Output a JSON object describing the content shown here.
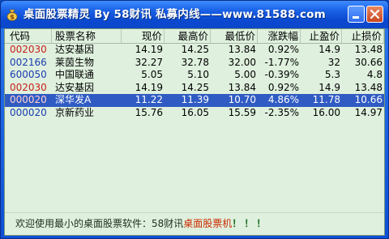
{
  "window": {
    "title": "桌面股票精灵 By 58财讯 私募内线——www.81588.com"
  },
  "table": {
    "columns": [
      "代码",
      "股票名称",
      "现价",
      "最高价",
      "最低价",
      "涨跌幅",
      "止盈价",
      "止损价"
    ],
    "rows": [
      {
        "code": "002030",
        "name": "达安基因",
        "price": "14.19",
        "high": "14.25",
        "low": "13.84",
        "change": "0.92%",
        "take_profit": "14.9",
        "stop_loss": "13.48",
        "code_color": "#c8201a"
      },
      {
        "code": "002166",
        "name": "莱茵生物",
        "price": "32.27",
        "high": "32.78",
        "low": "32.00",
        "change": "-1.77%",
        "take_profit": "32",
        "stop_loss": "30.66",
        "code_color": "#1a3bb0"
      },
      {
        "code": "600050",
        "name": "中国联通",
        "price": "5.05",
        "high": "5.10",
        "low": "5.00",
        "change": "-0.39%",
        "take_profit": "5.3",
        "stop_loss": "4.8",
        "code_color": "#1a3bb0"
      },
      {
        "code": "002030",
        "name": "达安基因",
        "price": "14.19",
        "high": "14.25",
        "low": "13.84",
        "change": "0.92%",
        "take_profit": "14.9",
        "stop_loss": "13.48",
        "code_color": "#c8201a"
      },
      {
        "code": "000020",
        "name": "深华发A",
        "price": "11.22",
        "high": "11.39",
        "low": "10.70",
        "change": "4.86%",
        "take_profit": "11.78",
        "stop_loss": "10.66",
        "code_color": "#ffd0d0",
        "selected": true
      },
      {
        "code": "000020",
        "name": "京新药业",
        "price": "15.76",
        "high": "16.05",
        "low": "15.59",
        "change": "-2.35%",
        "take_profit": "16.00",
        "stop_loss": "14.97",
        "code_color": "#1a3bb0"
      }
    ]
  },
  "status": {
    "prefix": "欢迎使用最小的桌面股票软件：58财讯",
    "brand": "桌面股票机",
    "suffix": "！！！"
  },
  "icons": {
    "app": "money-bag-icon",
    "minimize": "minimize-icon",
    "close": "close-icon"
  },
  "colors": {
    "title_bar": "#1a61e6",
    "content_bg": "#dff1de",
    "selected_row": "#2f5bc3"
  }
}
